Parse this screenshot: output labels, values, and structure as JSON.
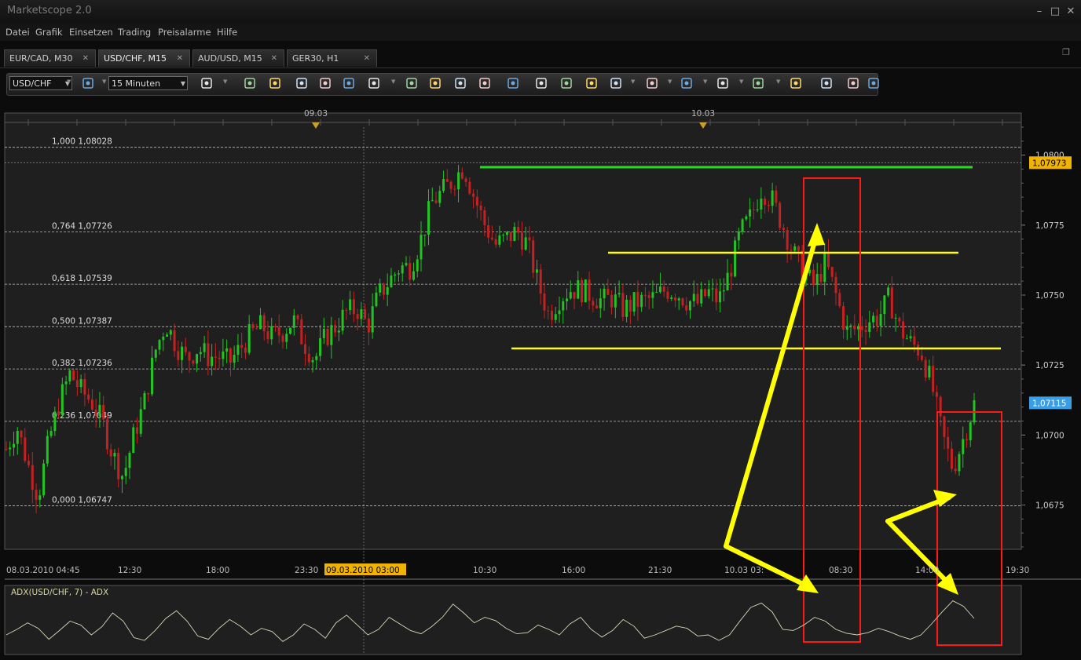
{
  "app": {
    "title": "Marketscope 2.0"
  },
  "window_controls": {
    "minimize": "–",
    "maximize": "□",
    "close": "✕"
  },
  "menu": [
    "Datei",
    "Grafik",
    "Einsetzen",
    "Trading",
    "Preisalarme",
    "Hilfe"
  ],
  "tabs": [
    {
      "label": "EUR/CAD, M30",
      "active": false
    },
    {
      "label": "USD/CHF, M15",
      "active": true
    },
    {
      "label": "AUD/USD, M15",
      "active": false
    },
    {
      "label": "GER30, H1",
      "active": false
    }
  ],
  "toolbar": {
    "symbol": "USD/CHF",
    "timeframe": "15 Minuten",
    "icons": [
      "symbol-lookup-icon",
      "chart-type-icon",
      "bar-chart-icon",
      "table-icon",
      "zoom-in-icon",
      "zoom-out-icon",
      "cursor-icon",
      "crosshair-icon",
      "indicator-icon",
      "signal-icon",
      "eye-icon",
      "globe-icon",
      "ruler-icon",
      "screenshot-icon",
      "print-icon",
      "trendline-icon",
      "channel-icon",
      "fan-icon",
      "pen-icon",
      "ellipse-icon",
      "marker-icon",
      "text-icon",
      "eraser-icon",
      "grid-icon",
      "settings-icon"
    ]
  },
  "colors": {
    "bull": "#22c322",
    "bear": "#c42222",
    "fib_line": "#bbbbbb",
    "green_line": "#22dd22",
    "yellow": "#ffff00",
    "red_box": "#ff1a1a",
    "current_price_bg": "#f0b400",
    "marker_price_bg": "#3a9ee6",
    "adx_line": "#d8d6b8"
  },
  "chart_data": {
    "type": "candlestick",
    "symbol": "USD/CHF",
    "timeframe": "M15",
    "ylim": [
      1.066,
      1.081
    ],
    "y_ticks": [
      "1,0800",
      "1,0775",
      "1,0750",
      "1,0725",
      "1,0700",
      "1,0675"
    ],
    "x_ticks": [
      "08.03.2010 04:45",
      "12:30",
      "18:00",
      "23:30",
      "09.03.2010 03:00",
      "16:00",
      "10:30",
      "16:00",
      "21:30",
      "10.03 03:",
      "08:30",
      "14:00",
      "19:30"
    ],
    "x_highlight": "09.03.2010 03:00",
    "day_markers": [
      "09.03",
      "10.03"
    ],
    "fibonacci": [
      {
        "label": "1,000 1,08028",
        "value": 1.08028
      },
      {
        "label": "0,764 1,07726",
        "value": 1.07726
      },
      {
        "label": "0,618 1,07539",
        "value": 1.07539
      },
      {
        "label": "0,500 1,07387",
        "value": 1.07387
      },
      {
        "label": "0,382 1,07236",
        "value": 1.07236
      },
      {
        "label": "0,236 1,07049",
        "value": 1.07049
      },
      {
        "label": "0,000 1,06747",
        "value": 1.06747
      }
    ],
    "current_price": "1,07973",
    "marker_price": "1,07115",
    "close_path": [
      1.0695,
      1.0703,
      1.069,
      1.0678,
      1.0698,
      1.0712,
      1.0722,
      1.0716,
      1.0712,
      1.0705,
      1.0693,
      1.0685,
      1.07,
      1.0712,
      1.073,
      1.074,
      1.0732,
      1.0727,
      1.0731,
      1.0728,
      1.0728,
      1.0726,
      1.0731,
      1.0736,
      1.0739,
      1.0735,
      1.0737,
      1.0741,
      1.0733,
      1.0727,
      1.0735,
      1.0739,
      1.0744,
      1.0745,
      1.0739,
      1.075,
      1.0755,
      1.076,
      1.076,
      1.077,
      1.0783,
      1.0787,
      1.0791,
      1.0796,
      1.0785,
      1.0775,
      1.0768,
      1.077,
      1.0773,
      1.0768,
      1.0754,
      1.0743,
      1.0749,
      1.0752,
      1.0752,
      1.075,
      1.0748,
      1.0749,
      1.0745,
      1.0747,
      1.0748,
      1.0749,
      1.0752,
      1.0751,
      1.0748,
      1.0747,
      1.0751,
      1.0748,
      1.0758,
      1.0772,
      1.0778,
      1.0788,
      1.0784,
      1.0775,
      1.0765,
      1.0758,
      1.0753,
      1.0762,
      1.075,
      1.0737,
      1.0738,
      1.0741,
      1.0742,
      1.0749,
      1.0738,
      1.0733,
      1.073,
      1.0718,
      1.07,
      1.0688,
      1.0699,
      1.0711
    ],
    "adx_series": [
      0.3,
      0.4,
      0.52,
      0.42,
      0.22,
      0.38,
      0.55,
      0.48,
      0.3,
      0.45,
      0.7,
      0.55,
      0.25,
      0.2,
      0.38,
      0.6,
      0.74,
      0.55,
      0.28,
      0.22,
      0.42,
      0.58,
      0.46,
      0.3,
      0.42,
      0.36,
      0.18,
      0.3,
      0.5,
      0.4,
      0.24,
      0.52,
      0.66,
      0.48,
      0.3,
      0.4,
      0.62,
      0.5,
      0.38,
      0.32,
      0.45,
      0.62,
      0.86,
      0.7,
      0.52,
      0.62,
      0.56,
      0.42,
      0.32,
      0.34,
      0.48,
      0.4,
      0.3,
      0.5,
      0.62,
      0.4,
      0.26,
      0.38,
      0.58,
      0.46,
      0.24,
      0.3,
      0.38,
      0.46,
      0.42,
      0.28,
      0.3,
      0.2,
      0.3,
      0.56,
      0.8,
      0.88,
      0.72,
      0.4,
      0.38,
      0.48,
      0.62,
      0.55,
      0.4,
      0.33,
      0.3,
      0.34,
      0.42,
      0.36,
      0.28,
      0.22,
      0.3,
      0.5,
      0.72,
      0.92,
      0.82,
      0.6
    ],
    "indicator_title": "ADX(USD/CHF, 7) - ADX"
  }
}
